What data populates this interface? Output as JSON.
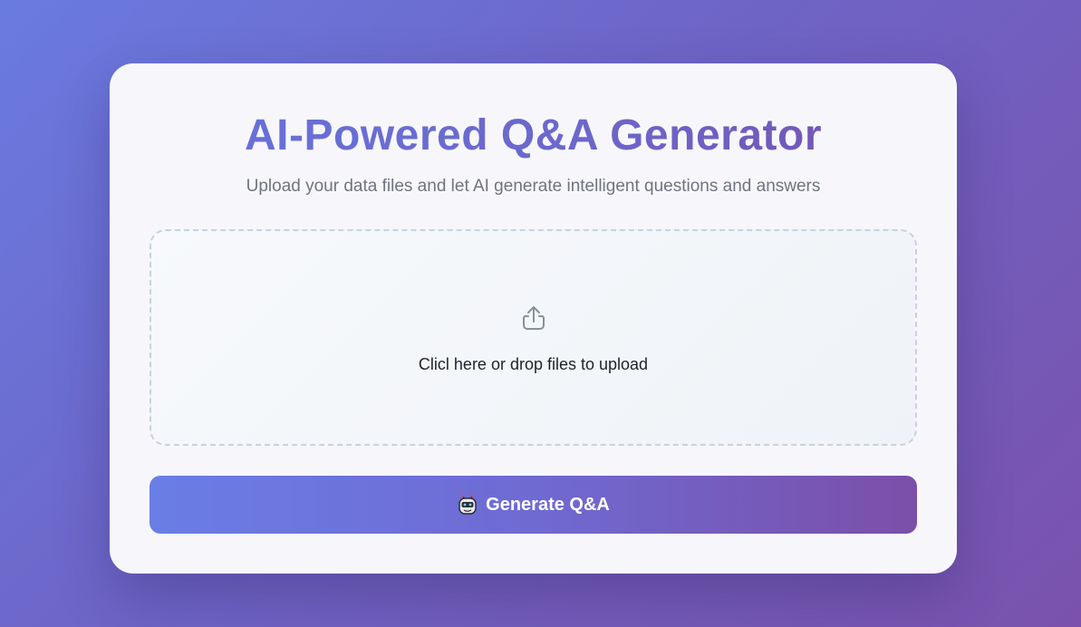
{
  "card": {
    "title": "AI-Powered Q&A Generator",
    "subtitle": "Upload your data files and let AI generate intelligent questions and answers"
  },
  "upload": {
    "icon": "upload-icon",
    "text": "Clicl here or drop files to upload"
  },
  "generate": {
    "icon": "robot-icon",
    "label": "Generate Q&A"
  },
  "colors": {
    "accent_start": "#6a7ee6",
    "accent_end": "#7b4fa8",
    "card_bg": "#f7f7fb"
  }
}
